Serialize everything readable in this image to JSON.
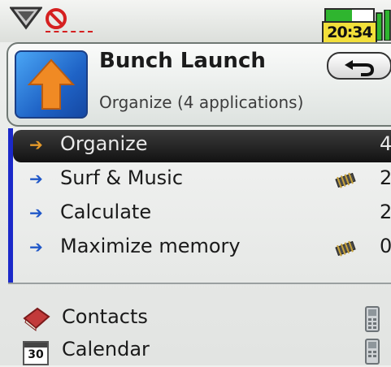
{
  "status": {
    "clock": "20:34",
    "battery_level": 0.55,
    "icons": [
      "signal-icon",
      "mute-icon",
      "battery-icon",
      "signal-bars-icon"
    ]
  },
  "header": {
    "title": "Bunch Launch",
    "subtitle": "Organize (4 applications)",
    "back_icon": "back-arrow-icon",
    "app_icon": "up-arrow-icon"
  },
  "bunches": [
    {
      "label": "Organize",
      "count": "4",
      "selected": true,
      "memory_icon": false
    },
    {
      "label": "Surf & Music",
      "count": "2",
      "selected": false,
      "memory_icon": true
    },
    {
      "label": "Calculate",
      "count": "2",
      "selected": false,
      "memory_icon": false
    },
    {
      "label": "Maximize memory",
      "count": "0",
      "selected": false,
      "memory_icon": true
    }
  ],
  "apps": [
    {
      "label": "Contacts",
      "icon": "contacts-book-icon"
    },
    {
      "label": "Calendar",
      "icon": "calendar-icon",
      "icon_text": "30"
    }
  ],
  "colors": {
    "accent_bar": "#1b29c9",
    "selected_row": "#121212",
    "arrow_blue": "#1f57c8",
    "arrow_orange": "#e59a2a"
  }
}
